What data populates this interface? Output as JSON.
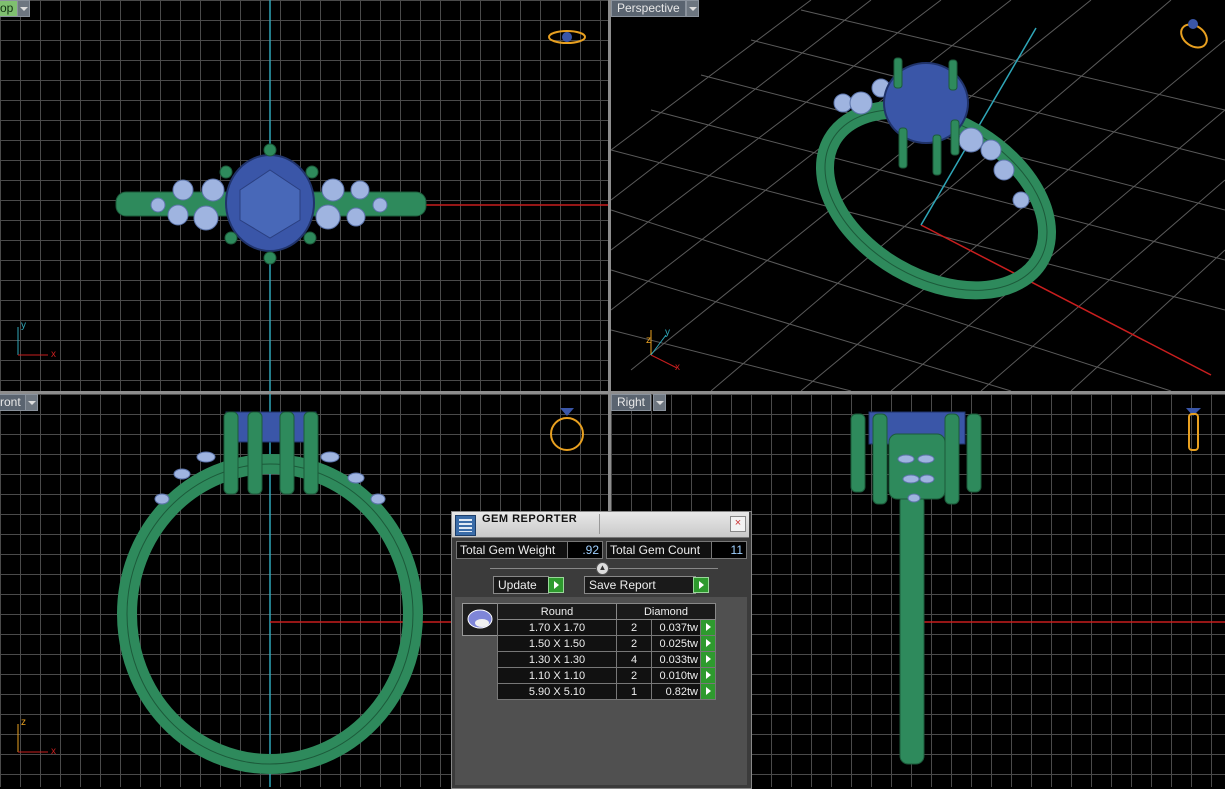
{
  "viewports": {
    "top": {
      "label": "op"
    },
    "perspective": {
      "label": "Perspective"
    },
    "front": {
      "label": "ront"
    },
    "right": {
      "label": "Right"
    }
  },
  "axes": {
    "x": "x",
    "y": "y",
    "z": "z"
  },
  "gem_reporter": {
    "title": "GEM REPORTER",
    "close_label": "×",
    "total_weight_label": "Total Gem Weight",
    "total_weight_value": ".92",
    "total_count_label": "Total Gem Count",
    "total_count_value": "11",
    "update_label": "Update",
    "save_report_label": "Save Report",
    "columns": {
      "shape": "Round",
      "material": "Diamond"
    },
    "rows": [
      {
        "size": "1.70 X 1.70",
        "qty": "2",
        "weight": "0.037tw"
      },
      {
        "size": "1.50 X 1.50",
        "qty": "2",
        "weight": "0.025tw"
      },
      {
        "size": "1.30 X 1.30",
        "qty": "4",
        "weight": "0.033tw"
      },
      {
        "size": "1.10 X 1.10",
        "qty": "2",
        "weight": "0.010tw"
      },
      {
        "size": "5.90 X 5.10",
        "qty": "1",
        "weight": "0.82tw"
      }
    ]
  },
  "colors": {
    "metal": "#2e8a5c",
    "sapphire": "#3a56a8",
    "diamond": "#9fb4e0",
    "axis_x": "#c81e1e",
    "axis_y": "#2fa6b8",
    "grid": "#4a4a4a"
  }
}
